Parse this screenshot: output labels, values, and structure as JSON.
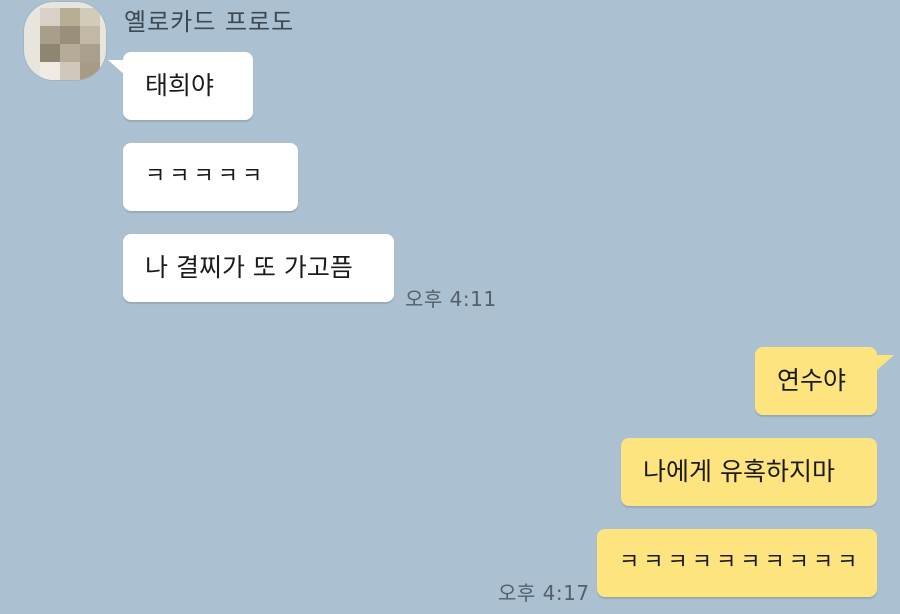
{
  "chat": {
    "sender_name": "옐로카드 프로도",
    "incoming": [
      {
        "text": "태희야"
      },
      {
        "text": "ㅋㅋㅋㅋㅋ"
      },
      {
        "text": "나 결찌가 또 가고픔"
      }
    ],
    "incoming_time": "오후 4:11",
    "outgoing": [
      {
        "text": "연수야"
      },
      {
        "text": "나에게 유혹하지마"
      },
      {
        "text": "ㅋㅋㅋㅋㅋㅋㅋㅋㅋㅋ"
      }
    ],
    "outgoing_time": "오후 4:17"
  },
  "colors": {
    "background": "#abc1d1",
    "incoming_bubble": "#ffffff",
    "outgoing_bubble": "#fde47f",
    "avatar_pixels": [
      "#d8d2c6",
      "#b8ad95",
      "#d3cbb9",
      "#a89e8a",
      "#9a8f7a",
      "#c2b8a6",
      "#8f8671",
      "#b5ab97",
      "#a99f8c",
      "#efebe3",
      "#cfc8ba",
      "#a59b87"
    ]
  },
  "icons": {
    "avatar": "pixelated-profile-photo"
  }
}
